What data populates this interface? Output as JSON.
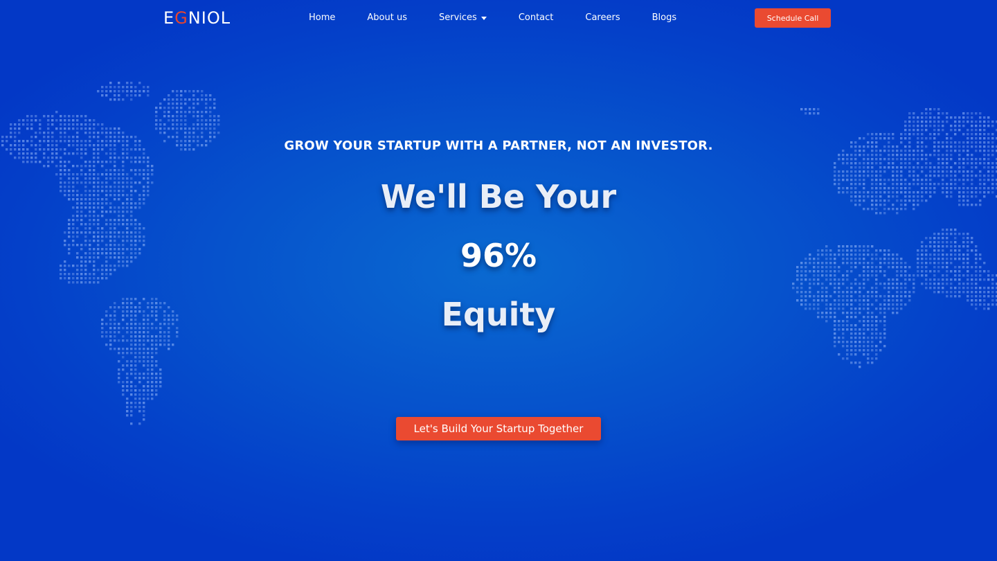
{
  "brand": {
    "logo_text_pre": "E",
    "logo_text_hi": "G",
    "logo_text_post": "NIOL",
    "accent_color": "#ea4a31",
    "background_color": "#0653cc"
  },
  "nav": {
    "items": [
      {
        "label": "Home"
      },
      {
        "label": "About us"
      },
      {
        "label": "Services",
        "has_dropdown": true
      },
      {
        "label": "Contact"
      },
      {
        "label": "Careers"
      },
      {
        "label": "Blogs"
      }
    ],
    "cta_label": "Schedule Call"
  },
  "hero": {
    "tagline": "GROW YOUR STARTUP WITH A PARTNER, NOT AN INVESTOR.",
    "headline_line_1": "We'll Be Your",
    "headline_line_2": "96%",
    "headline_line_3": "Equity",
    "cta_label": "Let's Build Your Startup Together"
  },
  "decorations": {
    "left_map": "world-map-dots-americas",
    "right_map": "world-map-dots-europe-africa"
  }
}
